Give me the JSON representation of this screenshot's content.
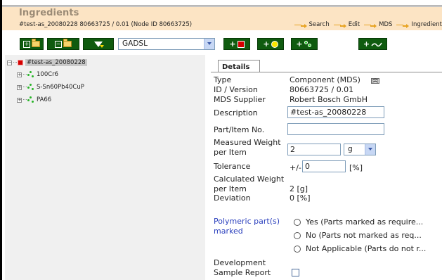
{
  "header": {
    "title": "Ingredients",
    "subtitle": "#test-as_20080228 80663725 / 0.01 (Node ID 80663725)",
    "breadcrumb": [
      "Search",
      "Edit",
      "MDS",
      "Ingredient"
    ]
  },
  "toolbar": {
    "selected_list": "GADSL",
    "buttons": [
      "add-folder-icon",
      "add-subfolder-icon",
      "filter-icon",
      "add-red-square-icon",
      "add-yellow-circle-icon",
      "add-green-circles-icon",
      "add-wave-icon"
    ]
  },
  "tree": {
    "root": "#test-as_20080228",
    "children": [
      "100Cr6",
      "S-Sn60Pb40CuP",
      "PA66"
    ]
  },
  "details": {
    "tab": "Details",
    "type_label": "Type",
    "type_value": "Component (MDS)",
    "id_label": "ID / Version",
    "id_value": "80663725 / 0.01",
    "supplier_label": "MDS Supplier",
    "supplier_value": "Robert Bosch GmbH",
    "description_label": "Description",
    "description_value": "#test-as_20080228",
    "part_label": "Part/Item No.",
    "part_value": "",
    "measured_label_1": "Measured Weight",
    "measured_label_2": "per Item",
    "measured_value": "2",
    "measured_unit": "g",
    "tolerance_label": "Tolerance",
    "tolerance_prefix": "+/-",
    "tolerance_value": "0",
    "tolerance_unit": "[%]",
    "calculated_label_1": "Calculated Weight",
    "calculated_label_2": "per Item",
    "calculated_value": "2 [g]",
    "deviation_label": "Deviation",
    "deviation_value": "0 [%]",
    "polymeric_label_1": "Polymeric part(s)",
    "polymeric_label_2": "marked",
    "polymeric_options": [
      "Yes (Parts marked as require...",
      "No (Parts not marked as req...",
      "Not Applicable (Parts do not r..."
    ],
    "dev_label_1": "Development",
    "dev_label_2": "Sample Report"
  }
}
